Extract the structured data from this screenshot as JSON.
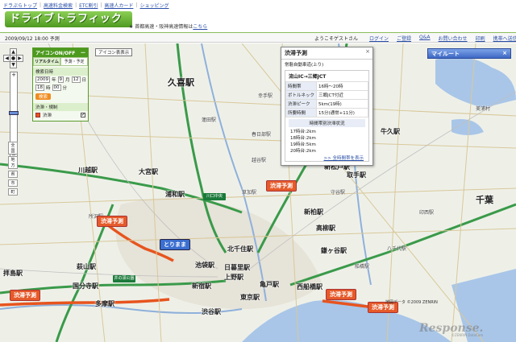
{
  "toplinks": [
    "ドラぷらトップ",
    "高速料金検索",
    "ETC割引",
    "高速人カード",
    "ショッピング"
  ],
  "brand": "ドライブトラフィック",
  "notice": {
    "prefix": "★ 首都高速・阪神高速情報は",
    "link": "こちら"
  },
  "status": {
    "datetime": "2009/09/12 18:00 予測",
    "welcome": "ようこそゲストさん",
    "nav": [
      "ログイン",
      "ご登録",
      "Q&A",
      "お問い合わせ",
      "印刷",
      "携帯へ送信"
    ]
  },
  "panel": {
    "title": "アイコンON/OFF",
    "title_right": "ー",
    "tabs": [
      "リアルタイム",
      "予測・予定"
    ],
    "section_date": "検索日時",
    "date": {
      "year": "2009",
      "year_unit": "年",
      "month": "9",
      "month_unit": "月",
      "day": "12",
      "day_unit": "日"
    },
    "time": {
      "hour": "18",
      "hour_unit": "時",
      "min": "00",
      "min_unit": "分"
    },
    "button": "検索",
    "section_legend": "渋滞・規制",
    "legend_item": "渋滞",
    "checked": "✔"
  },
  "icon_toggle": "アイコン表表示",
  "popup": {
    "title": "渋滞予測",
    "close": "×",
    "road": "常磐自動車道(上り)",
    "section": "流山IC→三郷JCT",
    "rows": [
      {
        "k": "時間帯",
        "v": "16時～20時"
      },
      {
        "k": "ボトルネック",
        "v": "三郷JCT付近"
      },
      {
        "k": "渋滞ピーク",
        "v": "5km(19時)"
      },
      {
        "k": "所要時間",
        "v": "15分(通常+11分)"
      }
    ],
    "sub": "時間帯別渋滞状況",
    "hours": [
      "17時台:2km",
      "18時台:2km",
      "19時台:5km",
      "20時台:2km"
    ],
    "more": ">> 全時間帯を表示"
  },
  "myroute": {
    "label": "マイルート",
    "close": "×"
  },
  "zoom": {
    "plus": "+",
    "minus": "−",
    "levels": [
      "全国",
      "地方",
      "県",
      "市",
      "町"
    ]
  },
  "pan": {
    "up": "▲",
    "down": "▼",
    "left": "◀",
    "right": "▶",
    "center": "●"
  },
  "places": [
    {
      "t": "久喜駅",
      "c": "big"
    },
    {
      "t": "牛久駅",
      "c": ""
    },
    {
      "t": "川越駅",
      "c": ""
    },
    {
      "t": "大宮駅",
      "c": ""
    },
    {
      "t": "浦和駅",
      "c": ""
    },
    {
      "t": "新松戸駅",
      "c": ""
    },
    {
      "t": "取手駅",
      "c": ""
    },
    {
      "t": "新柏駅",
      "c": ""
    },
    {
      "t": "千葉",
      "c": "big"
    },
    {
      "t": "高柳駅",
      "c": ""
    },
    {
      "t": "北千住駅",
      "c": ""
    },
    {
      "t": "鎌ヶ谷駅",
      "c": ""
    },
    {
      "t": "萩山駅",
      "c": ""
    },
    {
      "t": "拝島駅",
      "c": ""
    },
    {
      "t": "国分寺駅",
      "c": ""
    },
    {
      "t": "池袋駅",
      "c": ""
    },
    {
      "t": "日暮里駅",
      "c": ""
    },
    {
      "t": "上野駅",
      "c": ""
    },
    {
      "t": "新宿駅",
      "c": ""
    },
    {
      "t": "亀戸駅",
      "c": ""
    },
    {
      "t": "東京駅",
      "c": ""
    },
    {
      "t": "西船橋駅",
      "c": ""
    },
    {
      "t": "多摩駅",
      "c": ""
    },
    {
      "t": "渋谷駅",
      "c": ""
    },
    {
      "t": "蓮田駅",
      "c": "small"
    },
    {
      "t": "幸手駅",
      "c": "small"
    },
    {
      "t": "春日部駅",
      "c": "small"
    },
    {
      "t": "越谷駅",
      "c": "small"
    },
    {
      "t": "草加駅",
      "c": "small"
    },
    {
      "t": "所沢駅",
      "c": "small"
    },
    {
      "t": "印西駅",
      "c": "small"
    },
    {
      "t": "守谷駅",
      "c": "small"
    },
    {
      "t": "八千代駅",
      "c": "small"
    },
    {
      "t": "船橋駅",
      "c": "small"
    },
    {
      "t": "美浦村",
      "c": "small"
    }
  ],
  "callouts": [
    {
      "t": "渋滞予測",
      "c": ""
    },
    {
      "t": "渋滞予測",
      "c": ""
    },
    {
      "t": "渋滞予測",
      "c": ""
    },
    {
      "t": "渋滞予測",
      "c": ""
    },
    {
      "t": "渋滞予測",
      "c": ""
    },
    {
      "t": "とりまま",
      "c": "blue"
    }
  ],
  "signs": [
    "井の頭公園",
    "川口中央"
  ],
  "map_copyright": "地図データ ©2009 ZENRIN",
  "watermark": "Response.",
  "watermark_sub": "©ZENRIN DataCom"
}
